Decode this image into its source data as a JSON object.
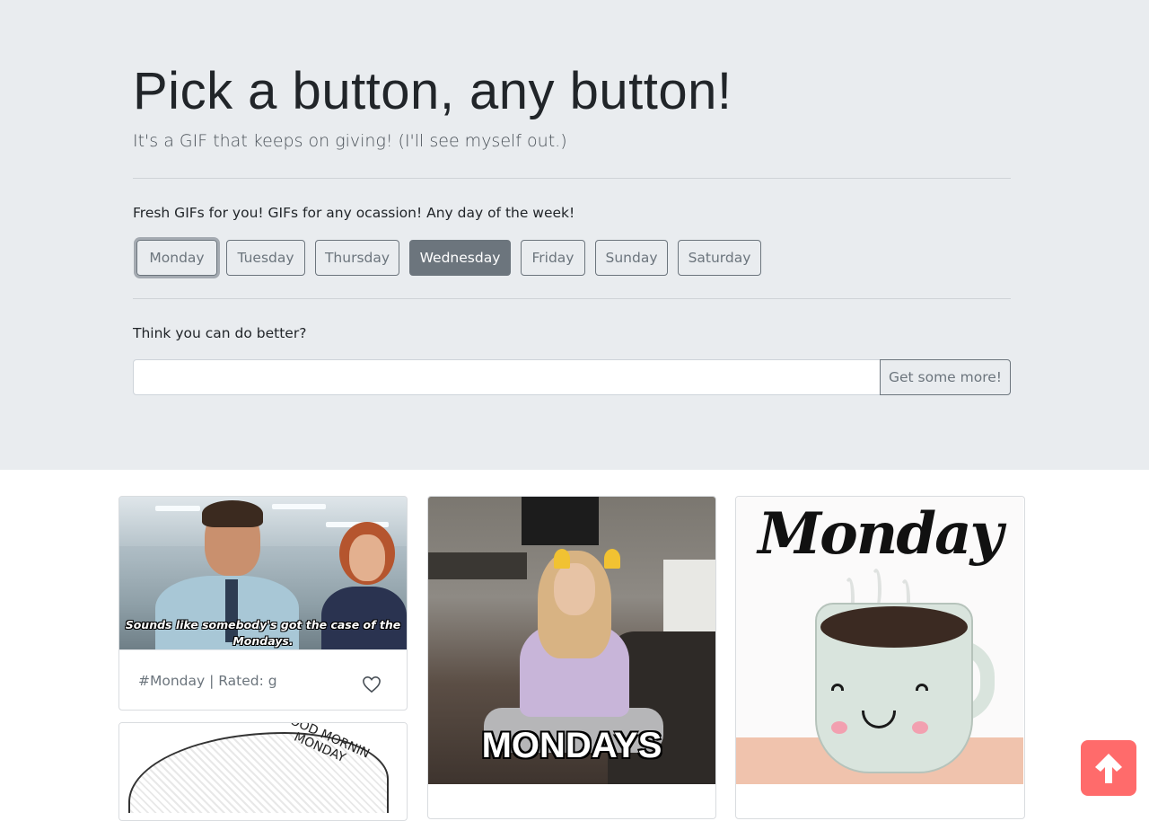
{
  "header": {
    "title": "Pick a button, any button!",
    "subtitle": "It's a GIF that keeps on giving! (I'll see myself out.)"
  },
  "days": {
    "prompt": "Fresh GIFs for you! GIFs for any ocassion! Any day of the week!",
    "buttons": [
      "Monday",
      "Tuesday",
      "Thursday",
      "Wednesday",
      "Friday",
      "Sunday",
      "Saturday"
    ],
    "active": "Wednesday",
    "focused": "Monday"
  },
  "search": {
    "prompt": "Think you can do better?",
    "value": "",
    "placeholder": "",
    "button_label": "Get some more!"
  },
  "cards": [
    {
      "gif_caption": "Sounds like somebody's got the case of the Mondays.",
      "meta": "#Monday | Rated: g",
      "favorite_icon": "heart-outline-icon"
    },
    {
      "gif_caption": "MONDAYS"
    },
    {
      "gif_caption": "Monday"
    },
    {
      "gif_caption": "GOOD MORNIN MONDAY"
    }
  ],
  "colors": {
    "jumbotron_bg": "#e9ecef",
    "secondary": "#6c757d",
    "scroll_top_bg": "#ff6b6b"
  },
  "scroll_top": {
    "icon": "arrow-up-icon"
  }
}
